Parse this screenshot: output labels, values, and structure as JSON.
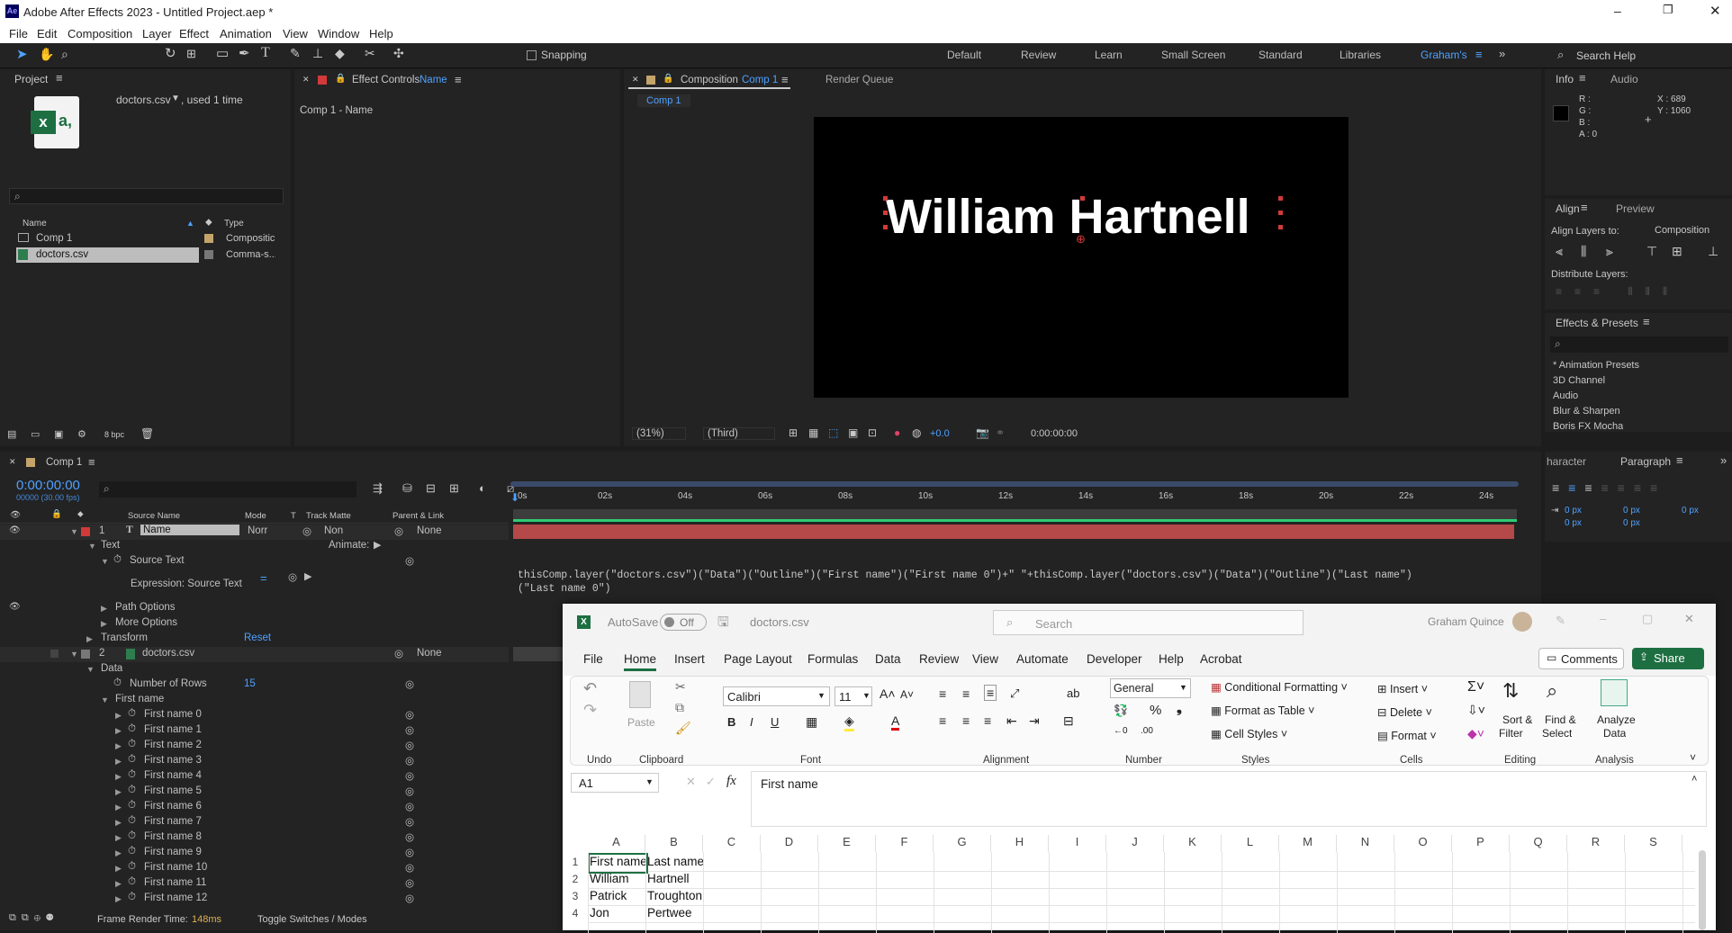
{
  "app": {
    "title": "Adobe After Effects 2023 - Untitled Project.aep *",
    "logo": "Ae"
  },
  "menu": [
    "File",
    "Edit",
    "Composition",
    "Layer",
    "Effect",
    "Animation",
    "View",
    "Window",
    "Help"
  ],
  "toolbar": {
    "snapping": "Snapping",
    "workspaces": [
      "Default",
      "Review",
      "Learn",
      "Small Screen",
      "Standard",
      "Libraries",
      "Graham's"
    ],
    "search_help": "Search Help"
  },
  "project": {
    "tab": "Project",
    "file_name": "doctors.csv",
    "used": ", used 1 time",
    "col_name": "Name",
    "col_type": "Type",
    "items": [
      {
        "name": "Comp 1",
        "type": "Compositic"
      },
      {
        "name": "doctors.csv",
        "type": "Comma-s..."
      }
    ],
    "bpc": "8 bpc"
  },
  "effect_controls": {
    "tab": "Effect Controls",
    "layer": "Name",
    "breadcrumb": "Comp 1 - Name"
  },
  "composition": {
    "tab": "Composition",
    "comp": "Comp 1",
    "render_queue": "Render Queue",
    "comp_tab": "Comp 1",
    "text": "William Hartnell",
    "zoom": "(31%)",
    "view": "(Third)",
    "exposure": "+0.0",
    "timecode": "0:00:00:00"
  },
  "info": {
    "tab": "Info",
    "audio": "Audio",
    "r": "R :",
    "g": "G :",
    "b": "B :",
    "a": "A : 0",
    "x": "X : 689",
    "y": "Y : 1060"
  },
  "align": {
    "tab": "Align",
    "preview": "Preview",
    "align_to_label": "Align Layers to:",
    "align_to": "Composition",
    "distribute": "Distribute Layers:"
  },
  "effects": {
    "tab": "Effects & Presets",
    "items": [
      "* Animation Presets",
      "3D Channel",
      "Audio",
      "Blur & Sharpen",
      "Boris FX Mocha"
    ]
  },
  "charpara": {
    "character": "haracter",
    "paragraph": "Paragraph",
    "v1": "0 px",
    "v2": "0 px",
    "v3": "0 px",
    "v4": "0 px",
    "v5": "0 px"
  },
  "timeline": {
    "tab": "Comp 1",
    "timecode": "0:00:00:00",
    "fps": "00000 (30.00 fps)",
    "headers": {
      "source": "Source Name",
      "mode": "Mode",
      "t": "T",
      "matte": "Track Matte",
      "parent": "Parent & Link"
    },
    "ruler": [
      "0s",
      "02s",
      "04s",
      "06s",
      "08s",
      "10s",
      "12s",
      "14s",
      "16s",
      "18s",
      "20s",
      "22s",
      "24s"
    ],
    "layer1": {
      "num": "1",
      "name": "Name",
      "mode": "Norr",
      "matte": "Non",
      "parent": "None"
    },
    "text": "Text",
    "animate": "Animate:",
    "source_text": "Source Text",
    "expression": "Expression: Source Text",
    "path_options": "Path Options",
    "more_options": "More Options",
    "transform": "Transform",
    "reset": "Reset",
    "layer2": {
      "num": "2",
      "name": "doctors.csv",
      "parent": "None"
    },
    "data": "Data",
    "rows_label": "Number of Rows",
    "rows_value": "15",
    "first_name": "First name",
    "first_names": [
      "First name 0",
      "First name 1",
      "First name 2",
      "First name 3",
      "First name 4",
      "First name 5",
      "First name 6",
      "First name 7",
      "First name 8",
      "First name 9",
      "First name 10",
      "First name 11",
      "First name 12"
    ],
    "expression_code": "thisComp.layer(\"doctors.csv\")(\"Data\")(\"Outline\")(\"First name\")(\"First name 0\")+\" \"+thisComp.layer(\"doctors.csv\")(\"Data\")(\"Outline\")(\"Last name\")",
    "expression_code2": "(\"Last name 0\")",
    "render_time_label": "Frame Render Time:",
    "render_time": "148ms",
    "toggle": "Toggle Switches / Modes"
  },
  "excel": {
    "autosave": "AutoSave",
    "off": "Off",
    "file": "doctors.csv",
    "search": "Search",
    "user": "Graham Quince",
    "tabs": [
      "File",
      "Home",
      "Insert",
      "Page Layout",
      "Formulas",
      "Data",
      "Review",
      "View",
      "Automate",
      "Developer",
      "Help",
      "Acrobat"
    ],
    "comments": "Comments",
    "share": "Share",
    "font": "Calibri",
    "size": "11",
    "number_format": "General",
    "groups": [
      "Undo",
      "Clipboard",
      "Font",
      "Alignment",
      "Number",
      "Styles",
      "Cells",
      "Editing",
      "Analysis"
    ],
    "paste": "Paste",
    "cond": "Conditional Formatting",
    "fmt_table": "Format as Table",
    "cell_styles": "Cell Styles",
    "insert": "Insert",
    "delete": "Delete",
    "format": "Format",
    "sort": "Sort &",
    "filter": "Filter",
    "find": "Find &",
    "select": "Select",
    "analyze": "Analyze",
    "analyze2": "Data",
    "namebox": "A1",
    "formula": "First name",
    "columns": [
      "A",
      "B",
      "C",
      "D",
      "E",
      "F",
      "G",
      "H",
      "I",
      "J",
      "K",
      "L",
      "M",
      "N",
      "O",
      "P",
      "Q",
      "R",
      "S"
    ],
    "rows": [
      [
        "First name",
        "Last name"
      ],
      [
        "William",
        "Hartnell"
      ],
      [
        "Patrick",
        "Troughton"
      ],
      [
        "Jon",
        "Pertwee"
      ]
    ]
  }
}
